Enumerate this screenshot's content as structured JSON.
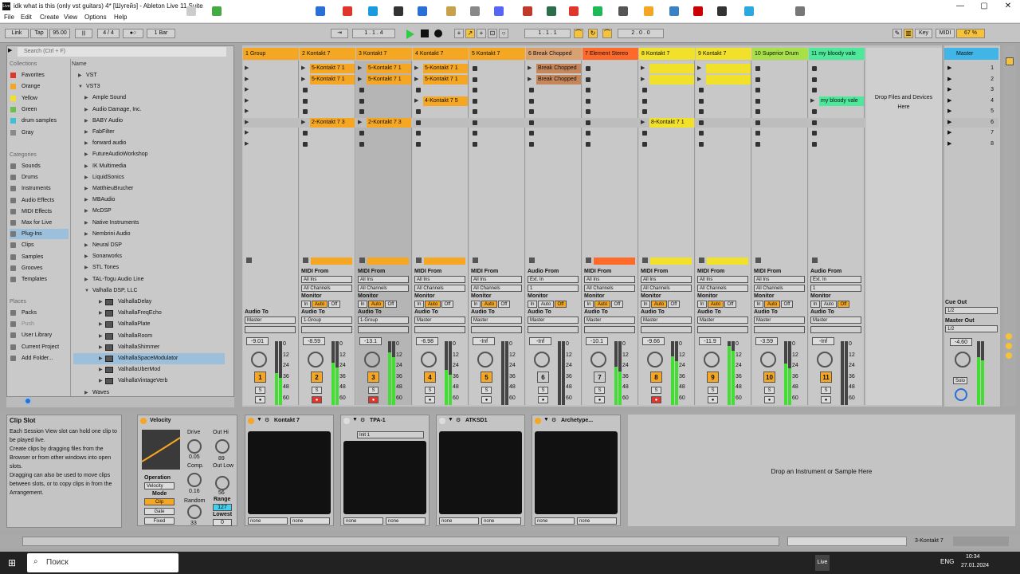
{
  "window": {
    "title": "idk what is this (only vst guitars) 4* [Шугейз] - Ableton Live 11 Suite",
    "minimize": "—",
    "maximize": "▢",
    "close": "✕"
  },
  "menu": [
    "File",
    "Edit",
    "Create",
    "View",
    "Options",
    "Help"
  ],
  "control_bar": {
    "link": "Link",
    "tap": "Tap",
    "tempo": "95.00",
    "time_sig": "4 / 4",
    "quantize": "1 Bar",
    "position": "1 . 1 . 4",
    "loop_start": "1 . 1 . 1",
    "loop_length": "2 . 0 . 0",
    "key": "Key",
    "midi": "MIDI",
    "cpu": "67 %"
  },
  "browser": {
    "search_placeholder": "Search (Ctrl + F)",
    "collections_title": "Collections",
    "collections": [
      {
        "label": "Favorites",
        "color": "#e0352b"
      },
      {
        "label": "Orange",
        "color": "#f5a623"
      },
      {
        "label": "Yellow",
        "color": "#f2e12b"
      },
      {
        "label": "Green",
        "color": "#6cc04a"
      },
      {
        "label": "drum samples",
        "color": "#3fbfd8"
      },
      {
        "label": "Gray",
        "color": "#8a8a8a"
      }
    ],
    "categories_title": "Categories",
    "categories": [
      "Sounds",
      "Drums",
      "Instruments",
      "Audio Effects",
      "MIDI Effects",
      "Max for Live",
      "Plug-Ins",
      "Clips",
      "Samples",
      "Grooves",
      "Templates"
    ],
    "places_title": "Places",
    "places": [
      "Packs",
      "Push",
      "User Library",
      "Current Project",
      "Add Folder..."
    ],
    "name_header": "Name",
    "tree": [
      {
        "label": "VST",
        "indent": 0
      },
      {
        "label": "VST3",
        "indent": 0
      },
      {
        "label": "Ample Sound",
        "indent": 1
      },
      {
        "label": "Audio Damage, Inc.",
        "indent": 1
      },
      {
        "label": "BABY Audio",
        "indent": 1
      },
      {
        "label": "FabFilter",
        "indent": 1
      },
      {
        "label": "forward audio",
        "indent": 1
      },
      {
        "label": "FutureAudioWorkshop",
        "indent": 1
      },
      {
        "label": "IK Multimedia",
        "indent": 1
      },
      {
        "label": "LiquidSonics",
        "indent": 1
      },
      {
        "label": "MatthieuBrucher",
        "indent": 1
      },
      {
        "label": "MBAudio",
        "indent": 1
      },
      {
        "label": "McDSP",
        "indent": 1
      },
      {
        "label": "Native Instruments",
        "indent": 1
      },
      {
        "label": "Nembrini Audio",
        "indent": 1
      },
      {
        "label": "Neural DSP",
        "indent": 1
      },
      {
        "label": "Sonarworks",
        "indent": 1
      },
      {
        "label": "STL Tones",
        "indent": 1
      },
      {
        "label": "TAL-Togu Audio Line",
        "indent": 1
      },
      {
        "label": "Valhalla DSP, LLC",
        "indent": 1
      },
      {
        "label": "ValhallaDelay",
        "indent": 2
      },
      {
        "label": "ValhallaFreqEcho",
        "indent": 2
      },
      {
        "label": "ValhallaPlate",
        "indent": 2
      },
      {
        "label": "ValhallaRoom",
        "indent": 2
      },
      {
        "label": "ValhallaShimmer",
        "indent": 2
      },
      {
        "label": "ValhallaSpaceModulator",
        "indent": 2
      },
      {
        "label": "ValhallaUberMod",
        "indent": 2
      },
      {
        "label": "ValhallaVintageVerb",
        "indent": 2
      },
      {
        "label": "Waves",
        "indent": 1
      }
    ]
  },
  "tracks": [
    {
      "name": "1 Group",
      "color": "#f5a623",
      "num": "1",
      "vol": "-9.01",
      "io_label": "",
      "audio_to": "Master",
      "input_a": "",
      "input_b": ""
    },
    {
      "name": "2 Kontakt 7",
      "color": "#f5a623",
      "num": "2",
      "vol": "-8.59",
      "io_label": "MIDI From",
      "audio_to": "1-Group",
      "input_a": "All Ins",
      "input_b": "All Channels"
    },
    {
      "name": "3 Kontakt 7",
      "color": "#f5a623",
      "num": "3",
      "vol": "-13.1",
      "io_label": "MIDI From",
      "audio_to": "1-Group",
      "input_a": "All Ins",
      "input_b": "All Channels"
    },
    {
      "name": "4 Kontakt 7",
      "color": "#f5a623",
      "num": "4",
      "vol": "-6.98",
      "io_label": "MIDI From",
      "audio_to": "Master",
      "input_a": "All Ins",
      "input_b": "All Channels"
    },
    {
      "name": "5 Kontakt 7",
      "color": "#f5a623",
      "num": "5",
      "vol": "-Inf",
      "io_label": "MIDI From",
      "audio_to": "Master",
      "input_a": "All Ins",
      "input_b": "All Channels"
    },
    {
      "name": "6 Break Chopped",
      "color": "#d9a070",
      "num": "6",
      "vol": "-Inf",
      "io_label": "Audio From",
      "audio_to": "Master",
      "input_a": "Ext. In",
      "input_b": "1"
    },
    {
      "name": "7 Element Stereo",
      "color": "#ff6a2b",
      "num": "7",
      "vol": "-10.1",
      "io_label": "MIDI From",
      "audio_to": "Master",
      "input_a": "All Ins",
      "input_b": "All Channels"
    },
    {
      "name": "8 Kontakt 7",
      "color": "#f2e12b",
      "num": "8",
      "vol": "-9.66",
      "io_label": "MIDI From",
      "audio_to": "Master",
      "input_a": "All Ins",
      "input_b": "All Channels"
    },
    {
      "name": "9 Kontakt 7",
      "color": "#f2e12b",
      "num": "9",
      "vol": "-11.9",
      "io_label": "MIDI From",
      "audio_to": "Master",
      "input_a": "All Ins",
      "input_b": "All Channels"
    },
    {
      "name": "10 Superior Drum",
      "color": "#a8e04a",
      "num": "10",
      "vol": "-3.59",
      "io_label": "MIDI From",
      "audio_to": "Master",
      "input_a": "All Ins",
      "input_b": "All Channels"
    },
    {
      "name": "11 my bloody vale",
      "color": "#4de89a",
      "num": "11",
      "vol": "-Inf",
      "io_label": "Audio From",
      "audio_to": "Master",
      "input_a": "Ext. In",
      "input_b": "1"
    }
  ],
  "clips": [
    {
      "track": 1,
      "row": 0,
      "label": "5-Kontakt 7 1",
      "color": "#f5a623"
    },
    {
      "track": 1,
      "row": 1,
      "label": "5-Kontakt 7 1",
      "color": "#f5a623"
    },
    {
      "track": 1,
      "row": 5,
      "label": "2-Kontakt 7 3",
      "color": "#f5a623"
    },
    {
      "track": 2,
      "row": 0,
      "label": "5-Kontakt 7 1",
      "color": "#f5a623"
    },
    {
      "track": 2,
      "row": 1,
      "label": "5-Kontakt 7 1",
      "color": "#f5a623"
    },
    {
      "track": 2,
      "row": 5,
      "label": "2-Kontakt 7 3",
      "color": "#f5a623"
    },
    {
      "track": 3,
      "row": 0,
      "label": "5-Kontakt 7 1",
      "color": "#f5a623"
    },
    {
      "track": 3,
      "row": 1,
      "label": "5-Kontakt 7 1",
      "color": "#f5a623"
    },
    {
      "track": 3,
      "row": 3,
      "label": "4-Kontakt 7 5",
      "color": "#f5a623"
    },
    {
      "track": 5,
      "row": 0,
      "label": "Break Chopped",
      "color": "#c6865a"
    },
    {
      "track": 5,
      "row": 1,
      "label": "Break Chopped",
      "color": "#c6865a"
    },
    {
      "track": 7,
      "row": 0,
      "label": "",
      "color": "#f2e12b"
    },
    {
      "track": 7,
      "row": 1,
      "label": "",
      "color": "#f2e12b"
    },
    {
      "track": 7,
      "row": 5,
      "label": "8-Kontakt 7 1",
      "color": "#f2e12b"
    },
    {
      "track": 8,
      "row": 0,
      "label": "",
      "color": "#f2e12b"
    },
    {
      "track": 8,
      "row": 1,
      "label": "",
      "color": "#f2e12b"
    },
    {
      "track": 10,
      "row": 3,
      "label": "my bloody vale",
      "color": "#4de89a"
    }
  ],
  "drop_area": "Drop Files and Devices Here",
  "monitor": {
    "label": "Monitor",
    "in": "In",
    "auto": "Auto",
    "off": "Off",
    "audio_to_label": "Audio To"
  },
  "master": {
    "name": "Master",
    "scenes": [
      "1",
      "2",
      "3",
      "4",
      "5",
      "6",
      "7",
      "8"
    ],
    "vol": "-4.60",
    "cue_label": "Cue Out",
    "cue_value": "1/2",
    "master_out_label": "Master Out",
    "master_out_value": "1/2",
    "solo": "Solo"
  },
  "meter_scale": [
    "0",
    "12",
    "24",
    "36",
    "48",
    "60"
  ],
  "info": {
    "title": "Clip Slot",
    "text": "Each Session View slot can hold one clip to be played live.\nCreate clips by dragging files from the Browser or from other windows into open slots.\nDragging can also be used to move clips between slots, or to copy clips in from the Arrangement."
  },
  "devices": {
    "velocity": {
      "name": "Velocity",
      "drive": "Drive",
      "drive_val": "0.05",
      "out_hi": "Out Hi",
      "out_hi_val": "89",
      "comp": "Comp.",
      "comp_val": "0.16",
      "out_low": "Out Low",
      "out_low_val": "56",
      "random": "Random",
      "random_val": "33",
      "operation": "Operation",
      "operation_val": "Velocity",
      "mode": "Mode",
      "clip": "Clip",
      "gate": "Gate",
      "fixed": "Fixed",
      "range": "Range",
      "range_val": "127",
      "lowest": "Lowest",
      "lowest_val": "0"
    },
    "plugins": [
      {
        "name": "Kontakt 7",
        "preset": ""
      },
      {
        "name": "TPA-1",
        "preset": "Init 1"
      },
      {
        "name": "ATKSD1",
        "preset": ""
      },
      {
        "name": "Archetype...",
        "preset": ""
      }
    ],
    "none": "none",
    "drop_instrument": "Drop an Instrument or Sample Here"
  },
  "status": {
    "track": "3-Kontakt 7"
  },
  "taskbar": {
    "search": "Поиск",
    "time": "10:34",
    "date": "27.01.2024",
    "lang": "ENG",
    "live": "Live"
  }
}
